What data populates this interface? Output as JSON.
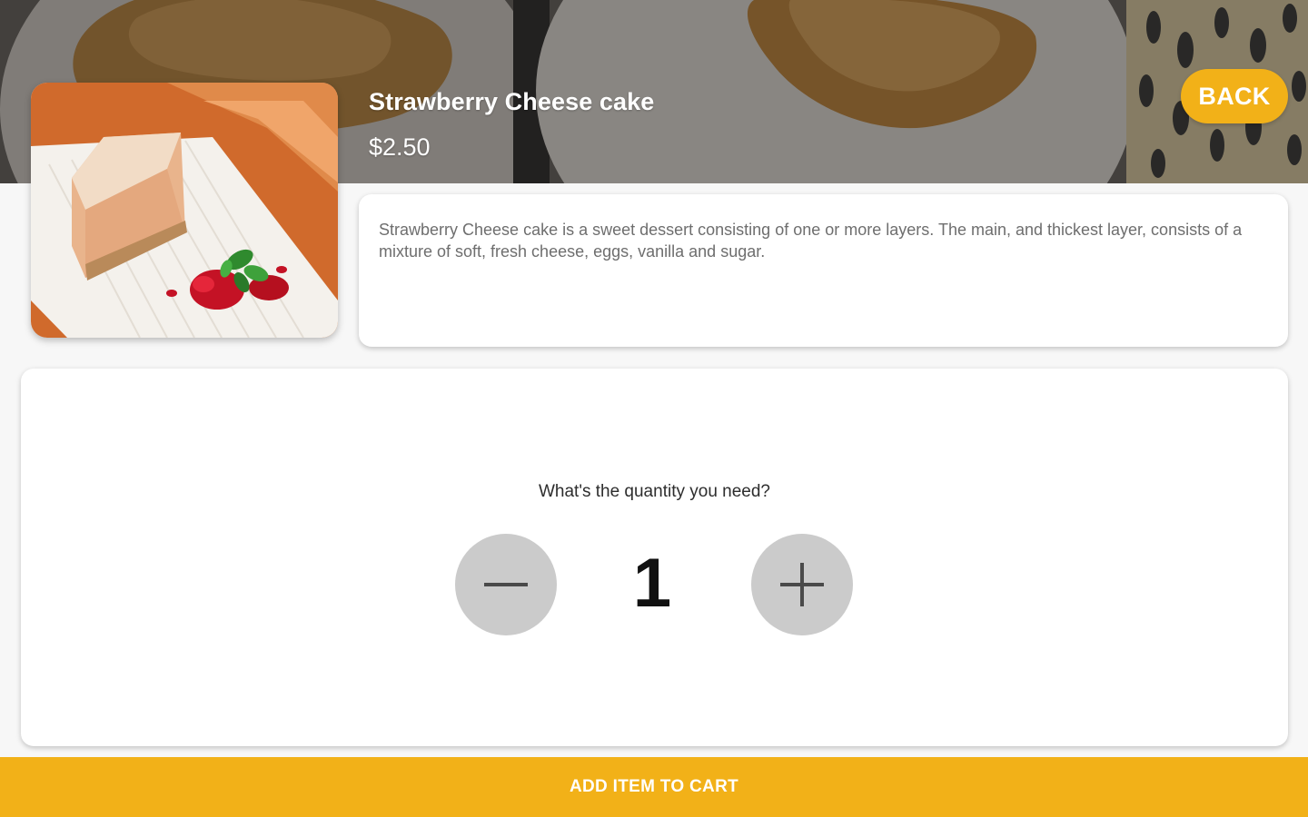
{
  "product": {
    "title": "Strawberry Cheese cake",
    "price": "$2.50",
    "description": "Strawberry Cheese cake is a sweet dessert consisting of one or more layers. The main, and thickest layer, consists of a mixture of soft, fresh cheese, eggs, vanilla and sugar.",
    "thumbnail_icon": "cheesecake-photo",
    "hero_icon": "croissant-banner-photo"
  },
  "header": {
    "back_label": "BACK"
  },
  "quantity": {
    "question": "What's the quantity you need?",
    "value": "1",
    "decrement_icon": "minus-icon",
    "increment_icon": "plus-icon"
  },
  "footer": {
    "add_to_cart_label": "ADD ITEM TO CART"
  },
  "colors": {
    "accent": "#f2b118",
    "stepper_button": "#cbcbcb",
    "background": "#f7f7f7",
    "card": "#ffffff"
  }
}
